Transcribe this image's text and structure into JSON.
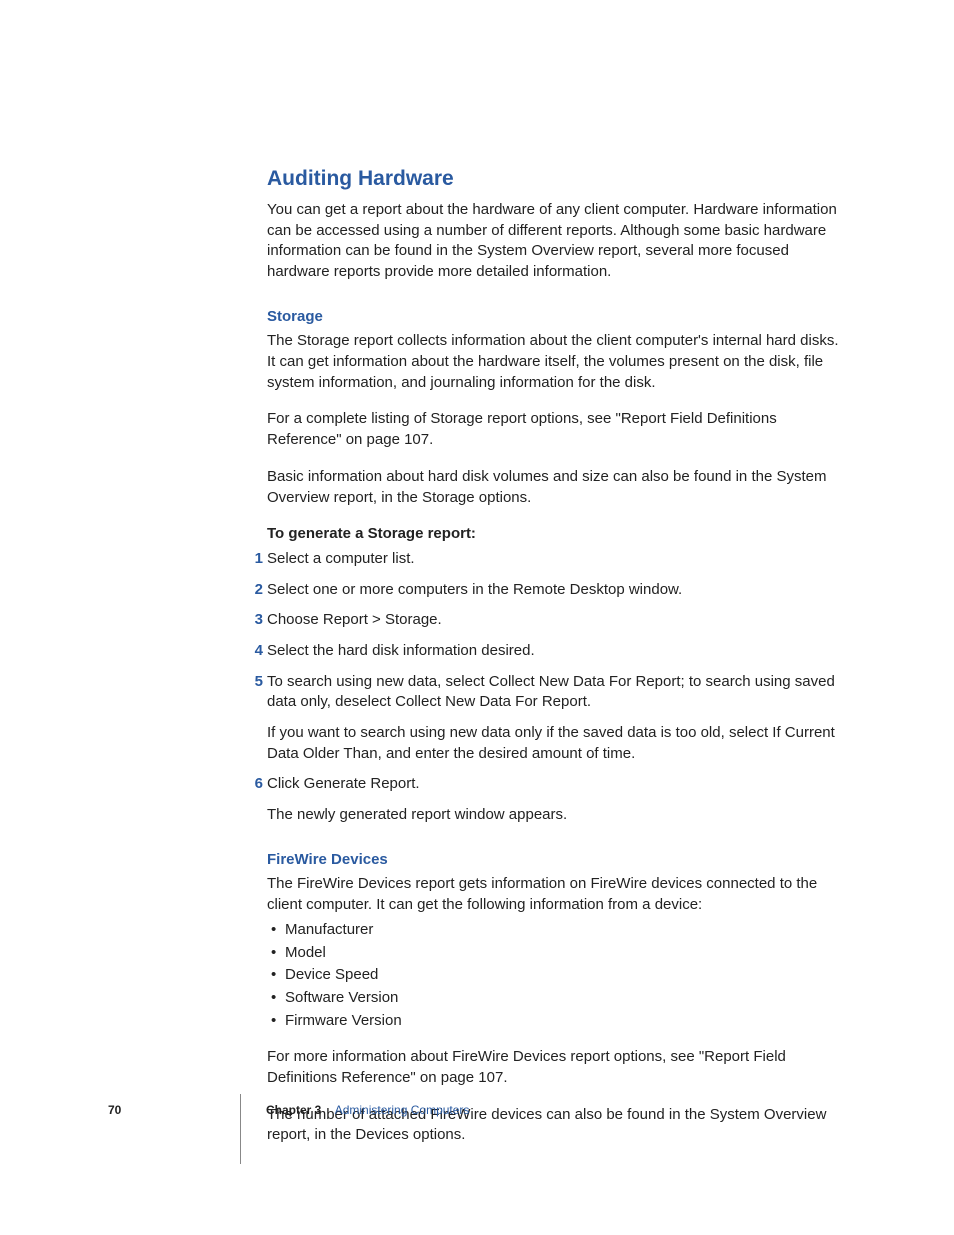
{
  "heading": "Auditing Hardware",
  "intro": "You can get a report about the hardware of any client computer. Hardware information can be accessed using a number of different reports. Although some basic hardware information can be found in the System Overview report, several more focused hardware reports provide more detailed information.",
  "storage": {
    "title": "Storage",
    "p1": "The Storage report collects information about the client computer's internal hard disks. It can get information about the hardware itself, the volumes present on the disk, file system information, and journaling information for the disk.",
    "p2": "For a complete listing of Storage report options, see \"Report Field Definitions Reference\" on page 107.",
    "p3": "Basic information about hard disk volumes and size can also be found in the System Overview report, in the Storage options.",
    "howto": "To generate a Storage report:",
    "steps": [
      {
        "n": "1",
        "t": "Select a computer list."
      },
      {
        "n": "2",
        "t": "Select one or more computers in the Remote Desktop window."
      },
      {
        "n": "3",
        "t": "Choose Report > Storage."
      },
      {
        "n": "4",
        "t": "Select the hard disk information desired."
      },
      {
        "n": "5",
        "t": "To search using new data, select Collect New Data For Report; to search using saved data only, deselect Collect New Data For Report.",
        "extra": "If you want to search using new data only if the saved data is too old, select If Current Data Older Than, and enter the desired amount of time."
      },
      {
        "n": "6",
        "t": "Click Generate Report.",
        "extra": "The newly generated report window appears."
      }
    ]
  },
  "firewire": {
    "title": "FireWire Devices",
    "p1": "The FireWire Devices report gets information on FireWire devices connected to the client computer. It can get the following information from a device:",
    "bullets": [
      "Manufacturer",
      "Model",
      "Device Speed",
      "Software Version",
      "Firmware Version"
    ],
    "p2": "For more information about FireWire Devices report options, see \"Report Field Definitions Reference\" on page 107.",
    "p3": "The number of attached FireWire devices can also be found in the System Overview report, in the Devices options."
  },
  "footer": {
    "page": "70",
    "chapter_label": "Chapter 3",
    "chapter_title": "Administering Computers"
  }
}
